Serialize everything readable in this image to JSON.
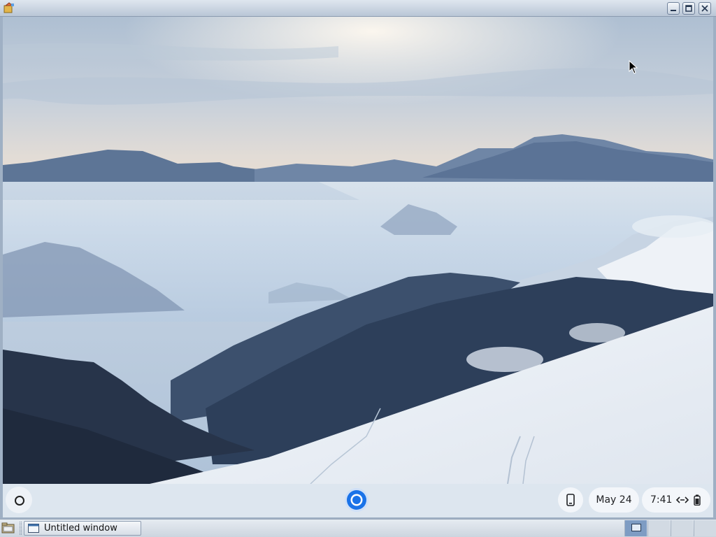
{
  "window": {
    "title": ""
  },
  "shelf": {
    "date": "May 24",
    "time": "7:41"
  },
  "taskbar": {
    "task_label": "Untitled window"
  },
  "icons": {
    "app": "app-icon",
    "minimize": "minimize-icon",
    "maximize": "maximize-icon",
    "close": "close-icon",
    "launcher": "launcher-icon",
    "browser": "chrome-browser-icon",
    "phone": "phone-hub-icon",
    "network": "network-icon",
    "battery": "battery-icon"
  },
  "colors": {
    "accent": "#1a73e8",
    "shelf": "#e2e9f2",
    "titlebar": "#c7d2df"
  }
}
